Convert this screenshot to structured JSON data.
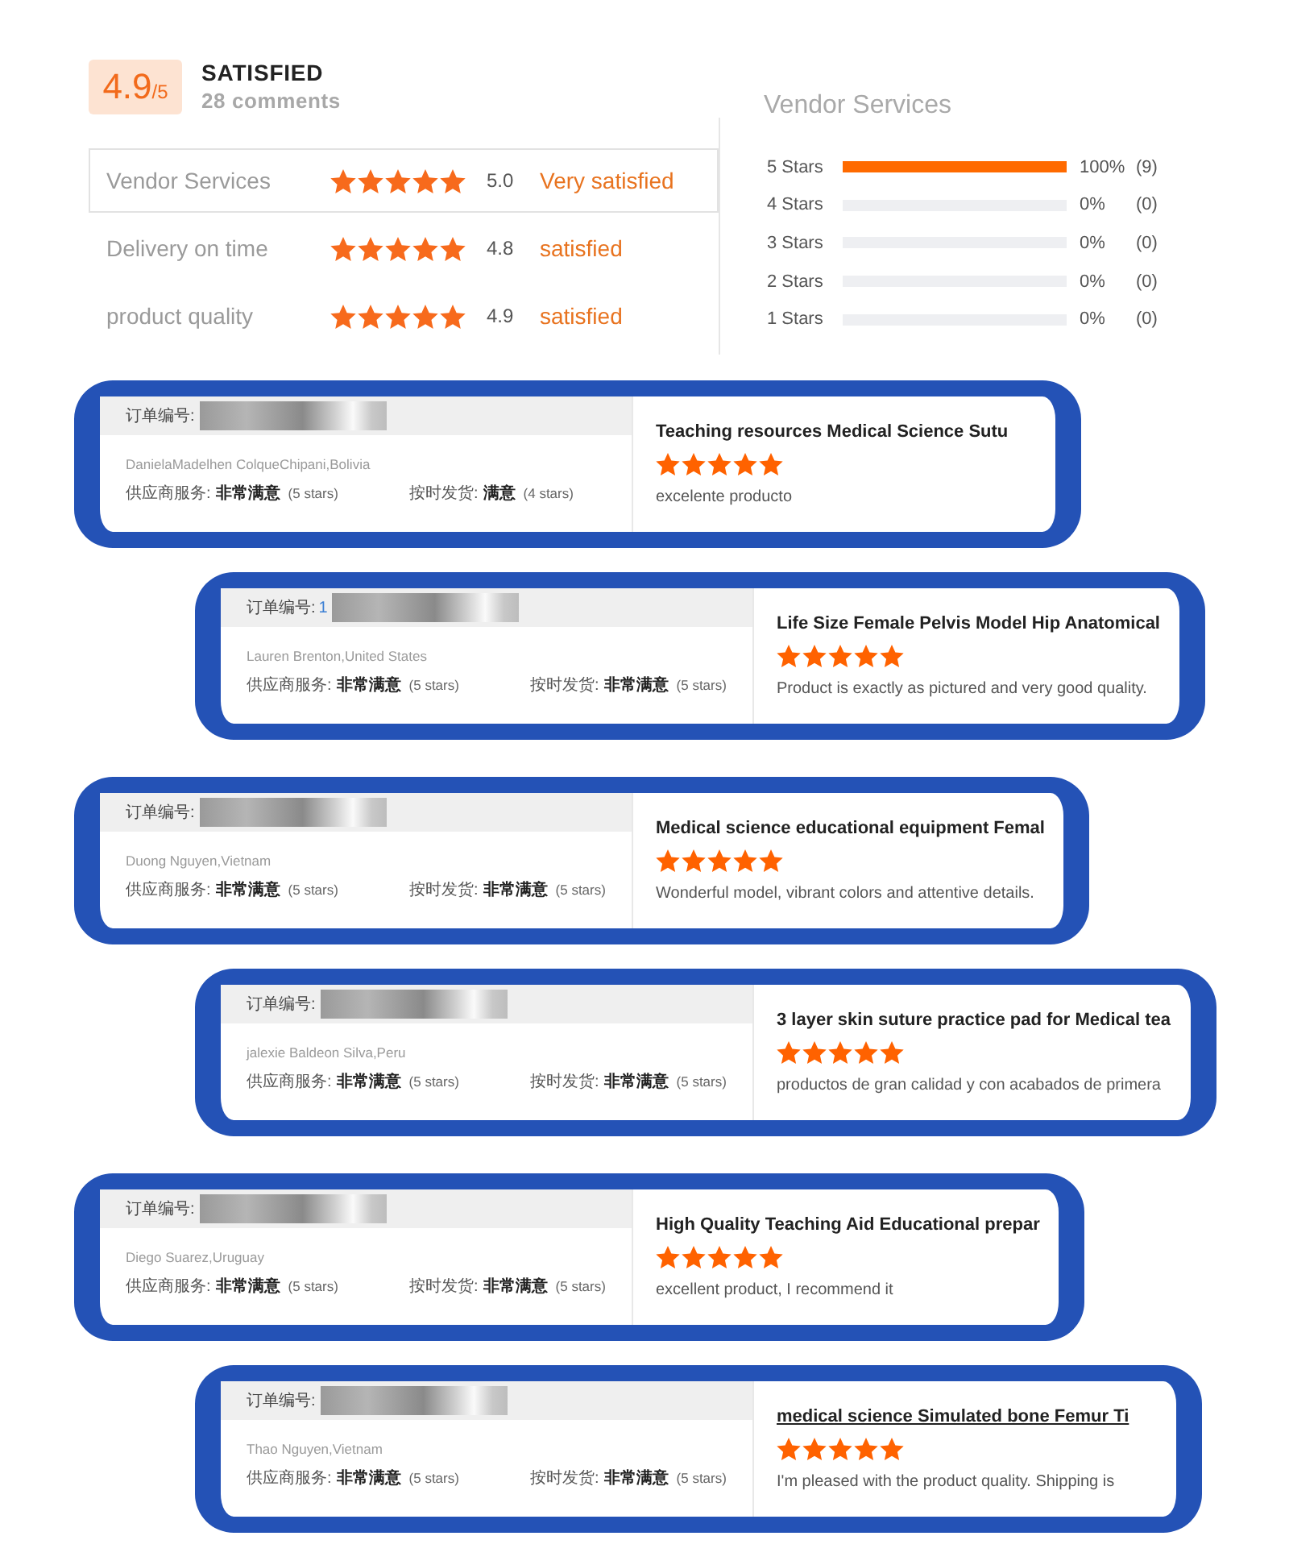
{
  "summary": {
    "score": "4.9",
    "score_max": "/5",
    "verdict": "SATISFIED",
    "comments": "28 comments",
    "ratings": [
      {
        "label": "Vendor Services",
        "stars": 5,
        "score": "5.0",
        "verdict": "Very satisfied",
        "selected": true
      },
      {
        "label": "Delivery on time",
        "stars": 5,
        "score": "4.8",
        "verdict": "satisfied",
        "selected": false
      },
      {
        "label": "product quality",
        "stars": 5,
        "score": "4.9",
        "verdict": "satisfied",
        "selected": false
      }
    ]
  },
  "distribution": {
    "title": "Vendor Services",
    "rows": [
      {
        "label": "5 Stars",
        "level": 1,
        "percent": "100%",
        "count": "(9)"
      },
      {
        "label": "4 Stars",
        "level": 0,
        "percent": "0%",
        "count": "(0)"
      },
      {
        "label": "3 Stars",
        "level": 0,
        "percent": "0%",
        "count": "(0)"
      },
      {
        "label": "2 Stars",
        "level": 0,
        "percent": "0%",
        "count": "(0)"
      },
      {
        "label": "1 Stars",
        "level": 0,
        "percent": "0%",
        "count": "(0)"
      }
    ]
  },
  "reviews": [
    {
      "order_label": "订单编号:",
      "reviewer": "DanielaMadelhen ColqueChipani,Bolivia",
      "ratings": [
        {
          "label": "供应商服务:",
          "value": "非常满意",
          "note": "(5 stars)"
        },
        {
          "label": "按时发货:",
          "value": "满意",
          "note": "(4 stars)"
        }
      ],
      "product": "Teaching resources Medical Science Sutu",
      "underlined": false,
      "stars": 5,
      "comment": "excelente producto"
    },
    {
      "order_label": "订单编号:",
      "order_prefix": "1",
      "reviewer": "Lauren Brenton,United States",
      "ratings": [
        {
          "label": "供应商服务:",
          "value": "非常满意",
          "note": "(5 stars)"
        },
        {
          "label": "按时发货:",
          "value": "非常满意",
          "note": "(5 stars)"
        }
      ],
      "product": "Life Size Female Pelvis Model Hip Anatomical",
      "underlined": false,
      "stars": 5,
      "comment": "Product is exactly as pictured and very good quality."
    },
    {
      "order_label": "订单编号:",
      "reviewer": "Duong Nguyen,Vietnam",
      "ratings": [
        {
          "label": "供应商服务:",
          "value": "非常满意",
          "note": "(5 stars)"
        },
        {
          "label": "按时发货:",
          "value": "非常满意",
          "note": "(5 stars)"
        }
      ],
      "product": "Medical science educational equipment Femal",
      "underlined": false,
      "stars": 5,
      "comment": "Wonderful model, vibrant colors and attentive details."
    },
    {
      "order_label": "订单编号:",
      "reviewer": "jalexie Baldeon Silva,Peru",
      "ratings": [
        {
          "label": "供应商服务:",
          "value": "非常满意",
          "note": "(5 stars)"
        },
        {
          "label": "按时发货:",
          "value": "非常满意",
          "note": "(5 stars)"
        }
      ],
      "product": "3 layer skin suture practice pad for Medical tea",
      "underlined": false,
      "stars": 5,
      "comment": "productos de gran calidad y con acabados de primera"
    },
    {
      "order_label": "订单编号:",
      "reviewer": "Diego Suarez,Uruguay",
      "ratings": [
        {
          "label": "供应商服务:",
          "value": "非常满意",
          "note": "(5 stars)"
        },
        {
          "label": "按时发货:",
          "value": "非常满意",
          "note": "(5 stars)"
        }
      ],
      "product": "High Quality Teaching Aid Educational prepar",
      "underlined": false,
      "stars": 5,
      "comment": "excellent product, I recommend it"
    },
    {
      "order_label": "订单编号:",
      "reviewer": "Thao Nguyen,Vietnam",
      "ratings": [
        {
          "label": "供应商服务:",
          "value": "非常满意",
          "note": "(5 stars)"
        },
        {
          "label": "按时发货:",
          "value": "非常满意",
          "note": "(5 stars)"
        }
      ],
      "product": "medical science Simulated bone Femur Ti",
      "underlined": true,
      "stars": 5,
      "comment": "I'm pleased with the product quality. Shipping is"
    }
  ]
}
